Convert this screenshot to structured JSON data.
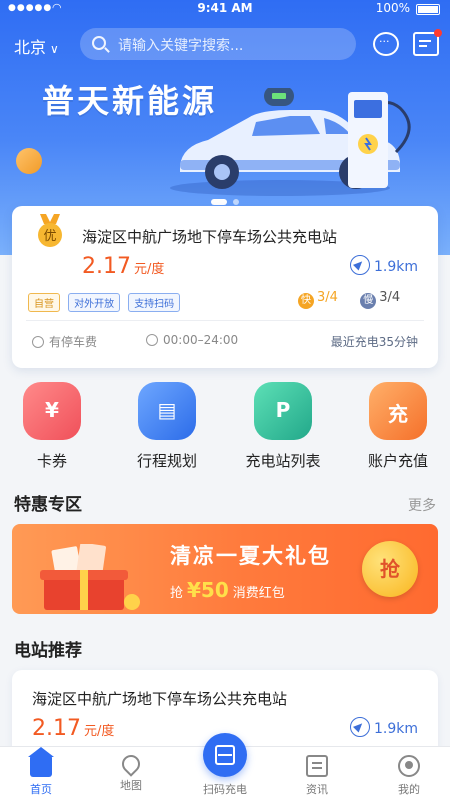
{
  "status_bar": {
    "signal": "●●●●●",
    "time": "9:41 AM",
    "battery": "100%"
  },
  "header": {
    "city": "北京",
    "search_placeholder": "请输入关键字搜索...",
    "icons": [
      "customer-service-icon",
      "message-icon"
    ]
  },
  "banner": {
    "title": "普天新能源",
    "dots": 2,
    "active_dot": 0
  },
  "featured_station": {
    "badge": "优",
    "name": "海淀区中航广场地下停车场公共充电站",
    "price": "2.17",
    "price_unit": "元/度",
    "distance": "1.9km",
    "tags": [
      "自营",
      "对外开放",
      "支持扫码"
    ],
    "fast_label": "快",
    "fast_count": "3/4",
    "slow_label": "慢",
    "slow_count": "3/4",
    "parking": "有停车费",
    "hours": "00:00–24:00",
    "recent": "最近充电35分钟"
  },
  "categories": [
    {
      "label": "卡券",
      "icon": "coupon-icon"
    },
    {
      "label": "行程规划",
      "icon": "route-plan-icon"
    },
    {
      "label": "充电站列表",
      "icon": "station-list-icon"
    },
    {
      "label": "账户充值",
      "icon": "recharge-icon"
    }
  ],
  "deals": {
    "title": "特惠专区",
    "more": "更多",
    "promo_title": "清凉一夏大礼包",
    "promo_prefix": "抢",
    "promo_amount": "¥50",
    "promo_suffix": "消费红包",
    "grab_label": "抢"
  },
  "recommend": {
    "title": "电站推荐",
    "station": {
      "name": "海淀区中航广场地下停车场公共充电站",
      "price": "2.17",
      "price_unit": "元/度",
      "distance": "1.9km"
    }
  },
  "tabbar": {
    "tabs": [
      {
        "label": "首页",
        "active": true
      },
      {
        "label": "地图",
        "active": false
      },
      {
        "label": "扫码充电",
        "active": false
      },
      {
        "label": "资讯",
        "active": false
      },
      {
        "label": "我的",
        "active": false
      }
    ]
  },
  "colors": {
    "primary": "#2f6df3",
    "price": "#f25a22",
    "promo": "#ff7a3c"
  }
}
